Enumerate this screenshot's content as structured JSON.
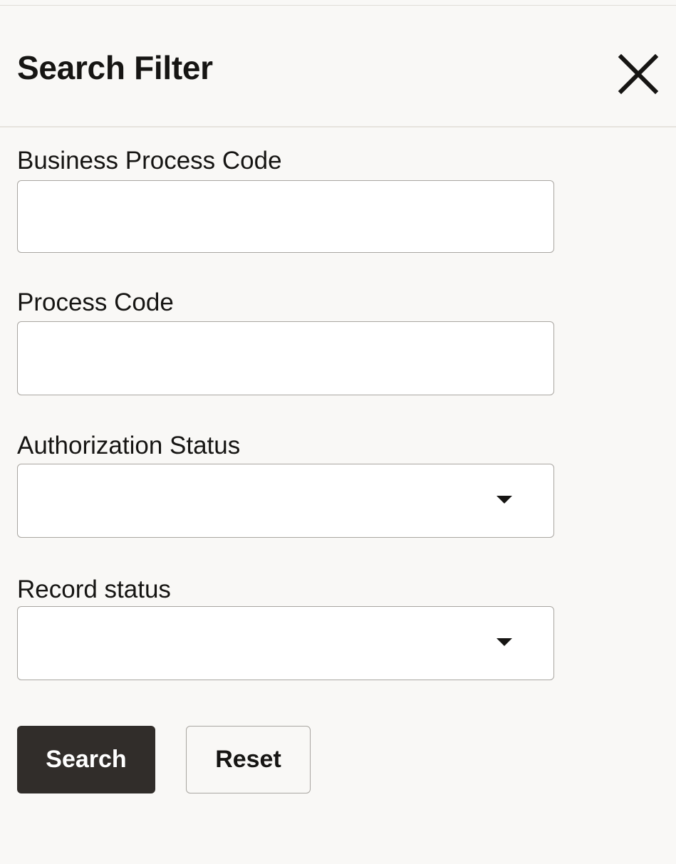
{
  "panel": {
    "title": "Search Filter",
    "close_icon": "close-icon"
  },
  "fields": {
    "business_process_code": {
      "label": "Business Process Code",
      "value": ""
    },
    "process_code": {
      "label": "Process Code",
      "value": ""
    },
    "authorization_status": {
      "label": "Authorization Status",
      "selected": "",
      "icon": "chevron-down-icon"
    },
    "record_status": {
      "label": "Record status",
      "selected": "",
      "icon": "chevron-down-icon"
    }
  },
  "actions": {
    "search_label": "Search",
    "reset_label": "Reset"
  },
  "colors": {
    "background": "#f9f8f6",
    "primary_button": "#312d2a",
    "text": "#161513",
    "border": "#a9a6a1"
  }
}
